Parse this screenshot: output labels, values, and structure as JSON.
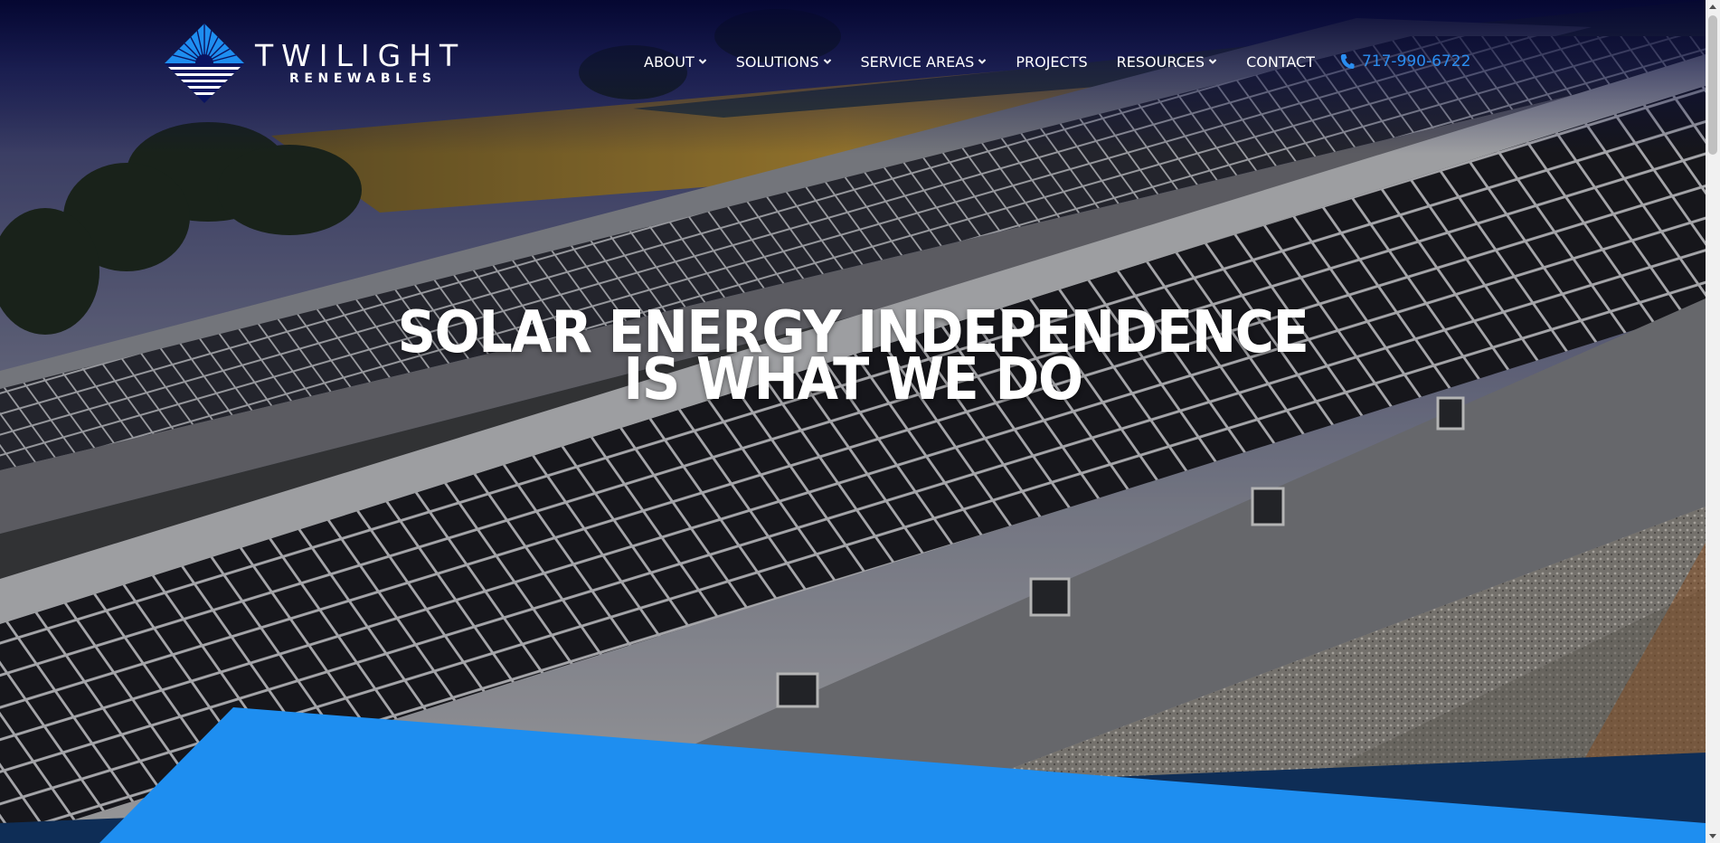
{
  "brand": {
    "name": "TWILIGHT",
    "tagline": "RENEWABLES",
    "logo_icon": "sunrise-diamond-logo",
    "accent_color": "#1e8ef0",
    "navy_color": "#0e2d56"
  },
  "nav": {
    "items": [
      {
        "label": "ABOUT",
        "has_dropdown": true
      },
      {
        "label": "SOLUTIONS",
        "has_dropdown": true
      },
      {
        "label": "SERVICE AREAS",
        "has_dropdown": true
      },
      {
        "label": "PROJECTS",
        "has_dropdown": false
      },
      {
        "label": "RESOURCES",
        "has_dropdown": true
      },
      {
        "label": "CONTACT",
        "has_dropdown": false
      }
    ],
    "phone": {
      "icon": "phone-icon",
      "number": "717-990-6722"
    }
  },
  "hero": {
    "headline_line1": "SOLAR ENERGY INDEPENDENCE",
    "headline_line2": "IS WHAT WE DO"
  }
}
